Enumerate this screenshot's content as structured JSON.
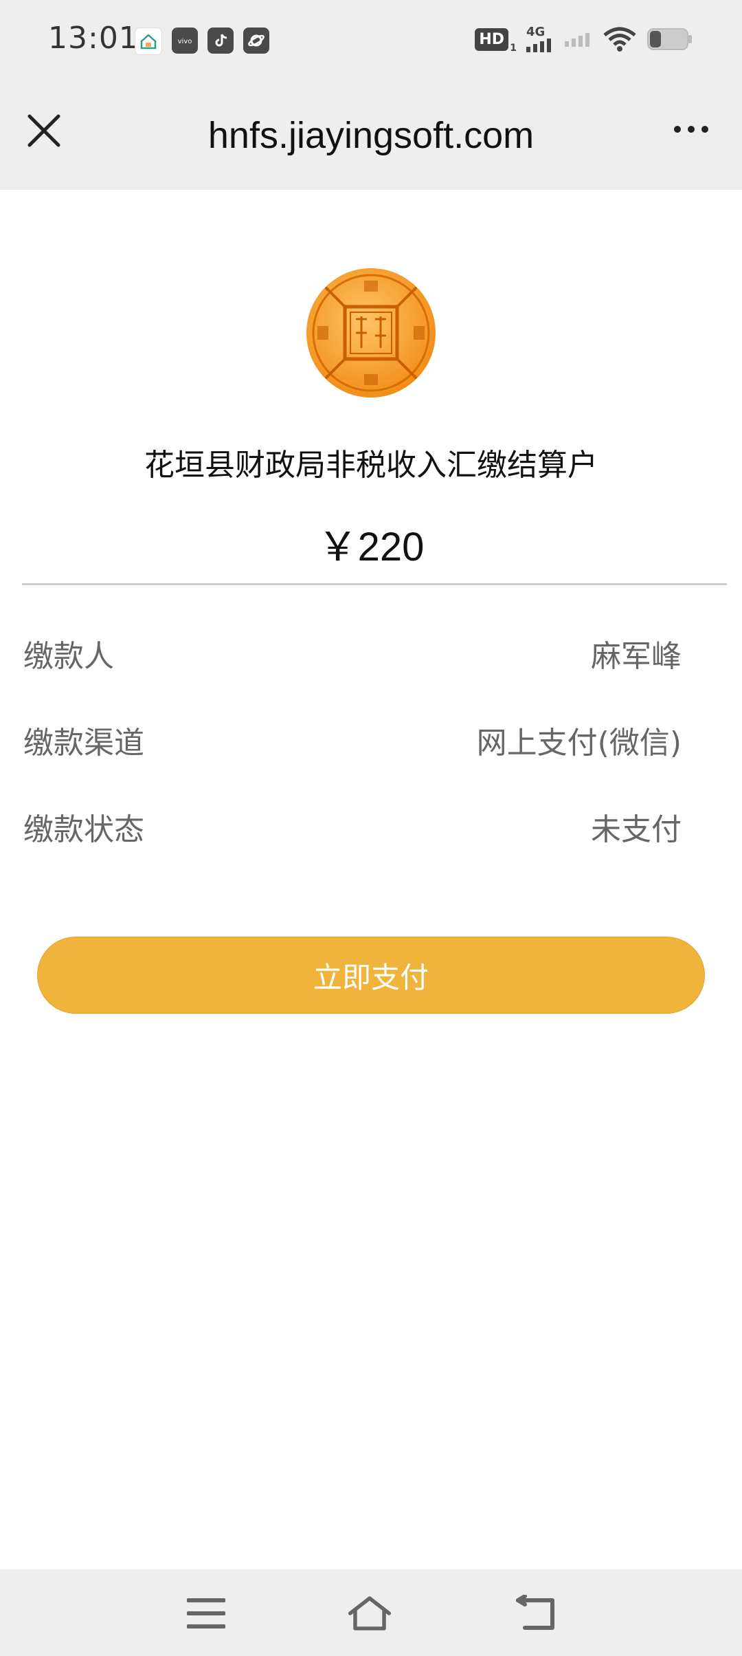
{
  "status_bar": {
    "time": "13:01",
    "app_icons": [
      "home-app-icon",
      "vivo-app-icon",
      "tiktok-icon",
      "planet-app-icon"
    ],
    "hd_label": "HD",
    "hd_sim": "1",
    "network_label": "4G",
    "indicators": [
      "signal-icon",
      "wifi-icon",
      "battery-icon"
    ]
  },
  "browser": {
    "url": "hnfs.jiayingsoft.com",
    "close_icon": "close-icon",
    "more_icon": "more-icon"
  },
  "payment": {
    "seal_icon": "hunan-finance-seal",
    "payee": "花垣县财政局非税收入汇缴结算户",
    "amount": "￥220",
    "fields": [
      {
        "label": "缴款人",
        "value": "麻军峰"
      },
      {
        "label": "缴款渠道",
        "value": "网上支付(微信)"
      },
      {
        "label": "缴款状态",
        "value": "未支付"
      }
    ],
    "pay_button_label": "立即支付",
    "button_color": "#f0b43c"
  },
  "nav_bar": {
    "buttons": [
      "menu-icon",
      "home-icon",
      "back-icon"
    ]
  }
}
